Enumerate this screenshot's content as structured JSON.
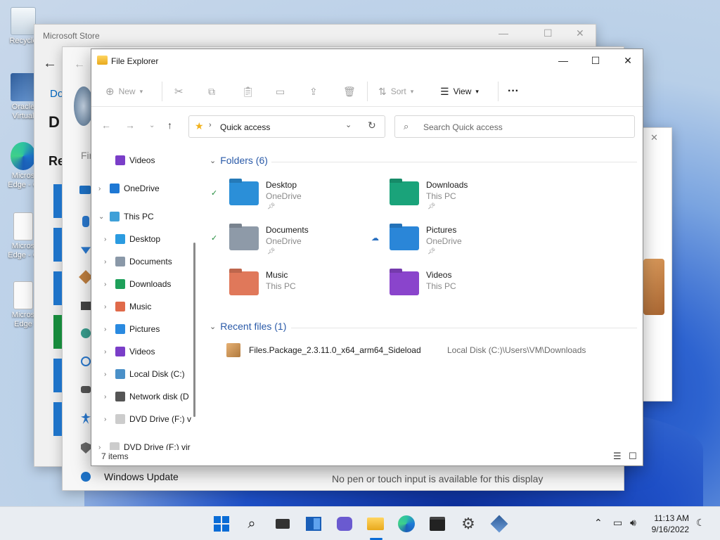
{
  "desktop": {
    "icons": [
      {
        "label": "Recycle",
        "kind": "recycle"
      },
      {
        "label": "Oracle Virtual",
        "kind": "vbox"
      },
      {
        "label": "Micros Edge - C",
        "kind": "edge"
      },
      {
        "label": "Micros Edge - C",
        "kind": "doc"
      },
      {
        "label": "Micros Edge",
        "kind": "doc"
      }
    ]
  },
  "store_window": {
    "title": "Microsoft Store",
    "partial_text": [
      "Do",
      "D",
      "Re",
      "Fir"
    ]
  },
  "settings_window": {
    "bottom_item": "Windows Update",
    "message": "No pen or touch input is available for this display"
  },
  "explorer": {
    "title": "File Explorer",
    "command_bar": {
      "new_label": "New",
      "sort_label": "Sort",
      "view_label": "View",
      "more_label": "···"
    },
    "address": {
      "location": "Quick access",
      "search_placeholder": "Search Quick access"
    },
    "nav": [
      {
        "label": "Videos",
        "level": 1,
        "chevron": "",
        "icon": "#7a3ec8"
      },
      {
        "label": "OneDrive",
        "level": 0,
        "chevron": "›",
        "icon": "#1e78d4"
      },
      {
        "label": "This PC",
        "level": 0,
        "chevron": "⌄",
        "icon": "#3fa0d8"
      },
      {
        "label": "Desktop",
        "level": 1,
        "chevron": "›",
        "icon": "#2b9be0"
      },
      {
        "label": "Documents",
        "level": 1,
        "chevron": "›",
        "icon": "#8a98a8"
      },
      {
        "label": "Downloads",
        "level": 1,
        "chevron": "›",
        "icon": "#1ea05a"
      },
      {
        "label": "Music",
        "level": 1,
        "chevron": "›",
        "icon": "#e06a4a"
      },
      {
        "label": "Pictures",
        "level": 1,
        "chevron": "›",
        "icon": "#2a8ae0"
      },
      {
        "label": "Videos",
        "level": 1,
        "chevron": "›",
        "icon": "#7a3ec8"
      },
      {
        "label": "Local Disk (C:)",
        "level": 1,
        "chevron": "›",
        "icon": "#4a90c8"
      },
      {
        "label": "Network disk (D",
        "level": 1,
        "chevron": "›",
        "icon": "#555555"
      },
      {
        "label": "DVD Drive (F:) v",
        "level": 1,
        "chevron": "›",
        "icon": "#cccccc"
      },
      {
        "label": "DVD Drive (F:) vir",
        "level": 0,
        "chevron": "›",
        "icon": "#cccccc"
      }
    ],
    "folders_header": "Folders (6)",
    "folders": [
      {
        "name": "Desktop",
        "sub": "OneDrive",
        "pinned": true,
        "status": "synced",
        "color": "#2b8fd8"
      },
      {
        "name": "Downloads",
        "sub": "This PC",
        "pinned": true,
        "status": "",
        "color": "#1aa37a"
      },
      {
        "name": "Documents",
        "sub": "OneDrive",
        "pinned": true,
        "status": "synced",
        "color": "#8e9aa8"
      },
      {
        "name": "Pictures",
        "sub": "OneDrive",
        "pinned": true,
        "status": "cloud",
        "color": "#2a86d8"
      },
      {
        "name": "Music",
        "sub": "This PC",
        "pinned": false,
        "status": "",
        "color": "#e0785a"
      },
      {
        "name": "Videos",
        "sub": "This PC",
        "pinned": false,
        "status": "",
        "color": "#8a44cc"
      }
    ],
    "recent_header": "Recent files (1)",
    "recent_files": [
      {
        "name": "Files.Package_2.3.11.0_x64_arm64_Sideload",
        "path": "Local Disk (C:)\\Users\\VM\\Downloads"
      }
    ],
    "status_count": "7 items"
  },
  "taskbar": {
    "clock_time": "11:13 AM",
    "clock_date": "9/16/2022"
  },
  "colors": {
    "accent": "#0067c0",
    "wallpaper_blue": "#1e4fc6"
  }
}
